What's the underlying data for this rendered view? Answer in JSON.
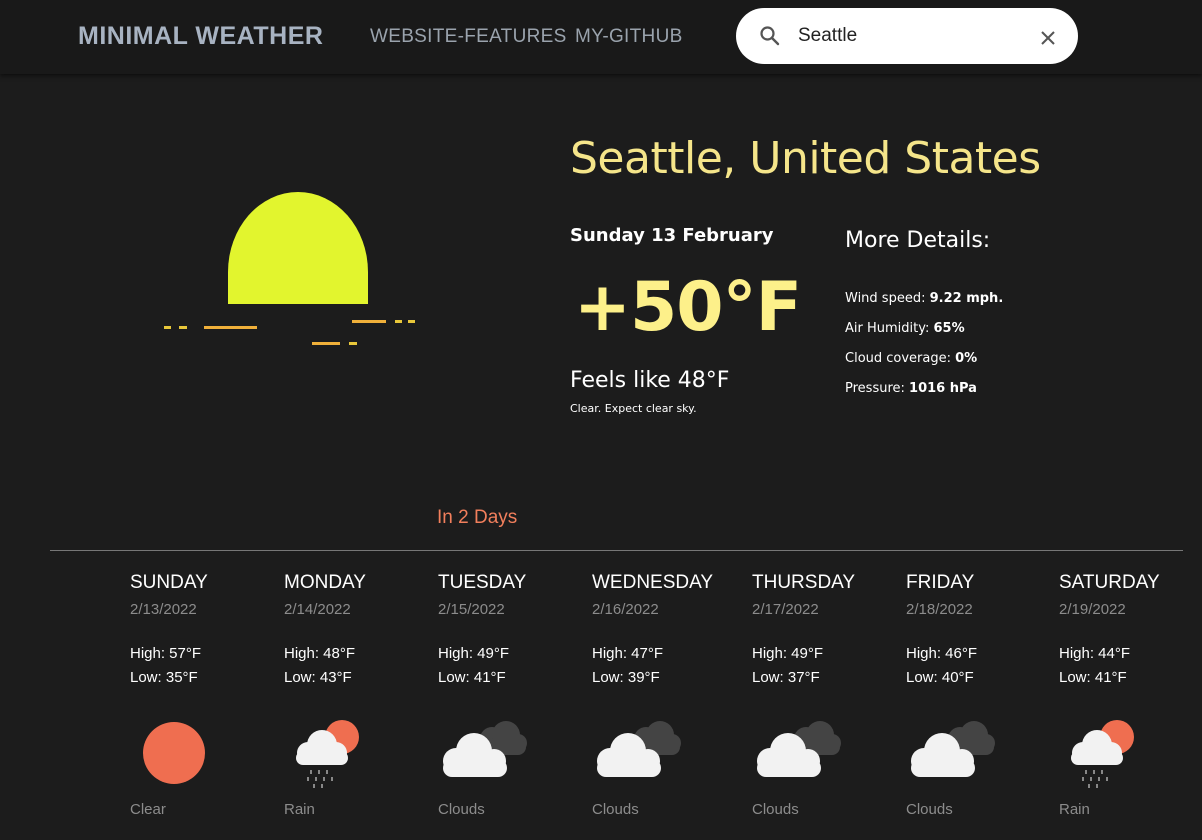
{
  "nav": {
    "brand": "MINIMAL WEATHER",
    "links": [
      "WEBSITE-FEATURES",
      "MY-GITHUB"
    ]
  },
  "search": {
    "value": "Seattle",
    "search_icon": "search-icon",
    "clear_icon": "close-icon"
  },
  "current": {
    "city": "Seattle, United States",
    "date": "Sunday 13 February",
    "temp": "+50°F",
    "feels_like": "Feels like 48°F",
    "description": "Clear. Expect clear sky.",
    "icon": "sunset-icon"
  },
  "details": {
    "title": "More Details:",
    "items": [
      {
        "label": "Wind speed:",
        "value": "9.22 mph."
      },
      {
        "label": "Air Humidity:",
        "value": "65%"
      },
      {
        "label": "Cloud coverage:",
        "value": "0%"
      },
      {
        "label": "Pressure:",
        "value": "1016 hPa"
      }
    ]
  },
  "in_days": "In 2 Days",
  "forecast": [
    {
      "day": "SUNDAY",
      "date": "2/13/2022",
      "high": "High: 57°F",
      "low": "Low: 35°F",
      "condition": "Clear",
      "icon": "sun-icon"
    },
    {
      "day": "MONDAY",
      "date": "2/14/2022",
      "high": "High: 48°F",
      "low": "Low: 43°F",
      "condition": "Rain",
      "icon": "rain-icon"
    },
    {
      "day": "TUESDAY",
      "date": "2/15/2022",
      "high": "High: 49°F",
      "low": "Low: 41°F",
      "condition": "Clouds",
      "icon": "clouds-icon"
    },
    {
      "day": "WEDNESDAY",
      "date": "2/16/2022",
      "high": "High: 47°F",
      "low": "Low: 39°F",
      "condition": "Clouds",
      "icon": "clouds-icon"
    },
    {
      "day": "THURSDAY",
      "date": "2/17/2022",
      "high": "High: 49°F",
      "low": "Low: 37°F",
      "condition": "Clouds",
      "icon": "clouds-icon"
    },
    {
      "day": "FRIDAY",
      "date": "2/18/2022",
      "high": "High: 46°F",
      "low": "Low: 40°F",
      "condition": "Clouds",
      "icon": "clouds-icon"
    },
    {
      "day": "SATURDAY",
      "date": "2/19/2022",
      "high": "High: 44°F",
      "low": "Low: 41°F",
      "condition": "Rain",
      "icon": "rain-icon"
    }
  ],
  "colors": {
    "background": "#1c1c1c",
    "accent_yellow": "#fdf08a",
    "accent_orange": "#f27f5c",
    "sun_yellow": "#e2f52e"
  }
}
